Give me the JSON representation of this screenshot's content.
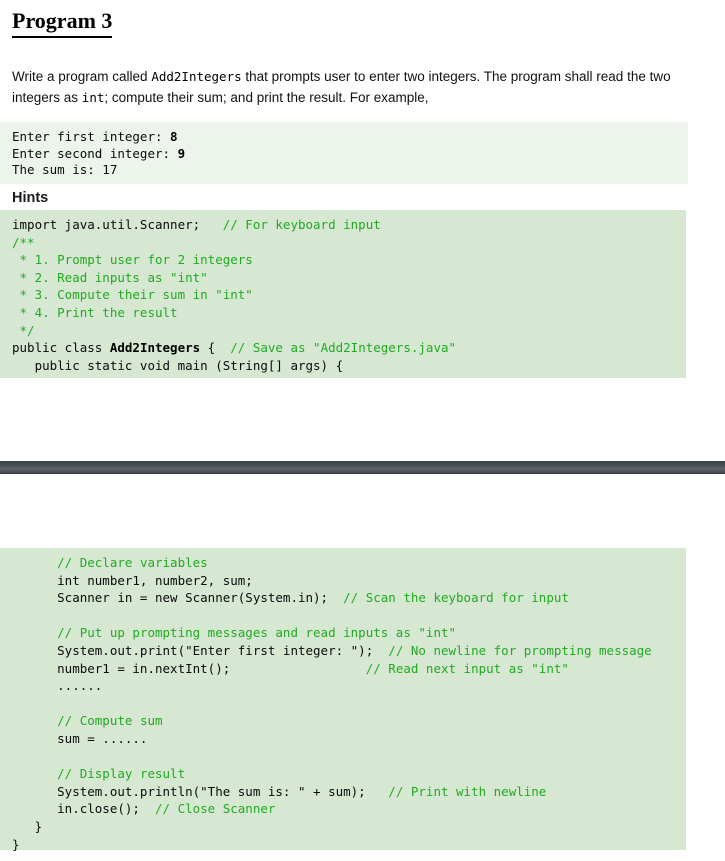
{
  "page": {
    "title": "Program 3"
  },
  "intro": {
    "part1": "Write a program called ",
    "code1": "Add2Integers",
    "part2": " that prompts user to enter two integers. The program shall read the two integers as ",
    "code2": "int",
    "part3": "; compute their sum; and print the result. For example,"
  },
  "sample_output": {
    "lines": [
      {
        "prompt": "Enter first integer: ",
        "input": "8"
      },
      {
        "prompt": "Enter second integer: ",
        "input": "9"
      },
      {
        "prompt": "The sum is: 17",
        "input": ""
      }
    ]
  },
  "hints": {
    "heading": "Hints",
    "lines": [
      {
        "code": "import java.util.Scanner;   ",
        "comment": "// For keyboard input",
        "bold": ""
      },
      {
        "code": "",
        "comment": "/**",
        "bold": ""
      },
      {
        "code": "",
        "comment": " * 1. Prompt user for 2 integers",
        "bold": ""
      },
      {
        "code": "",
        "comment": " * 2. Read inputs as \"int\"",
        "bold": ""
      },
      {
        "code": "",
        "comment": " * 3. Compute their sum in \"int\"",
        "bold": ""
      },
      {
        "code": "",
        "comment": " * 4. Print the result",
        "bold": ""
      },
      {
        "code": "",
        "comment": " */",
        "bold": ""
      },
      {
        "code": "public class ",
        "bold": "Add2Integers",
        "code_after": " {  ",
        "comment": "// Save as \"Add2Integers.java\""
      },
      {
        "code": "   public static void main (String[] args) {",
        "comment": "",
        "bold": ""
      }
    ]
  },
  "body_code": {
    "lines": [
      {
        "code": "      ",
        "comment": "// Declare variables"
      },
      {
        "code": "      int number1, number2, sum;",
        "comment": ""
      },
      {
        "code": "      Scanner in = new Scanner(System.in);  ",
        "comment": "// Scan the keyboard for input"
      },
      {
        "code": "",
        "comment": ""
      },
      {
        "code": "      ",
        "comment": "// Put up prompting messages and read inputs as \"int\""
      },
      {
        "code": "      System.out.print(\"Enter first integer: \");  ",
        "comment": "// No newline for prompting message"
      },
      {
        "code": "      number1 = in.nextInt();                  ",
        "comment": "// Read next input as \"int\""
      },
      {
        "code": "      ......",
        "comment": ""
      },
      {
        "code": "",
        "comment": ""
      },
      {
        "code": "      ",
        "comment": "// Compute sum"
      },
      {
        "code": "      sum = ......",
        "comment": ""
      },
      {
        "code": "",
        "comment": ""
      },
      {
        "code": "      ",
        "comment": "// Display result"
      },
      {
        "code": "      System.out.println(\"The sum is: \" + sum);   ",
        "comment": "// Print with newline"
      },
      {
        "code": "      in.close();  ",
        "comment": "// Close Scanner"
      },
      {
        "code": "   }",
        "comment": ""
      },
      {
        "code": "}",
        "comment": ""
      }
    ]
  },
  "colors": {
    "output_block_bg": "#ecf4ec",
    "code_block_bg": "#d6e7d2",
    "comment_green": "#22aa22",
    "separator_dark": "#4a5055",
    "text": "#0b0b0b"
  }
}
